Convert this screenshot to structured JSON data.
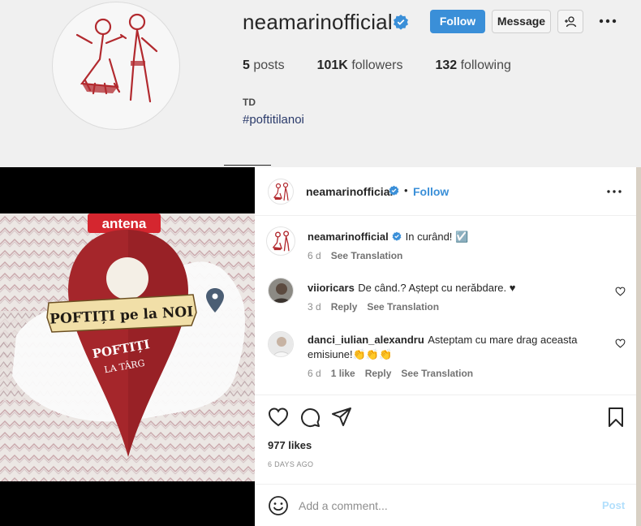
{
  "profile": {
    "username": "neamarinofficial",
    "follow_label": "Follow",
    "message_label": "Message",
    "stats": {
      "posts_count": "5",
      "posts_label": "posts",
      "followers_count": "101K",
      "followers_label": "followers",
      "following_count": "132",
      "following_label": "following"
    },
    "bio_name": "TD",
    "bio_hashtag": "#poftitilanoi"
  },
  "media": {
    "brand_logo": "antena",
    "show_title_line1": "POFTIȚI pe la NOI",
    "pin_text_1": "POFTIȚI",
    "pin_text_2": "LA TÂRG"
  },
  "post": {
    "header": {
      "username": "neamarinofficial",
      "dot": "•",
      "follow_label": "Follow"
    },
    "caption": {
      "username": "neamarinofficial",
      "text": "In curând! ☑️",
      "time": "6 d",
      "see_translation": "See Translation"
    },
    "comments": [
      {
        "username": "viioricars",
        "text": "De când.? Aștept cu nerăbdare. ♥",
        "time": "3 d",
        "reply": "Reply",
        "see_translation": "See Translation"
      },
      {
        "username": "danci_iulian_alexandru",
        "text": "Asteptam cu mare drag aceasta emisiune!👏👏👏",
        "time": "6 d",
        "likes": "1 like",
        "reply": "Reply",
        "see_translation": "See Translation"
      }
    ],
    "likes": "977 likes",
    "posted_ago": "6 DAYS AGO",
    "comment_placeholder": "Add a comment...",
    "post_label": "Post"
  },
  "colors": {
    "accent": "#3a8fd8",
    "brand_red": "#b22a2f",
    "text": "#262626",
    "muted": "#8e8e8e"
  },
  "icons": [
    "verified-badge-icon",
    "add-person-icon",
    "more-options-icon",
    "heart-icon",
    "comment-icon",
    "share-icon",
    "bookmark-icon",
    "emoji-icon",
    "location-pin-icon"
  ]
}
